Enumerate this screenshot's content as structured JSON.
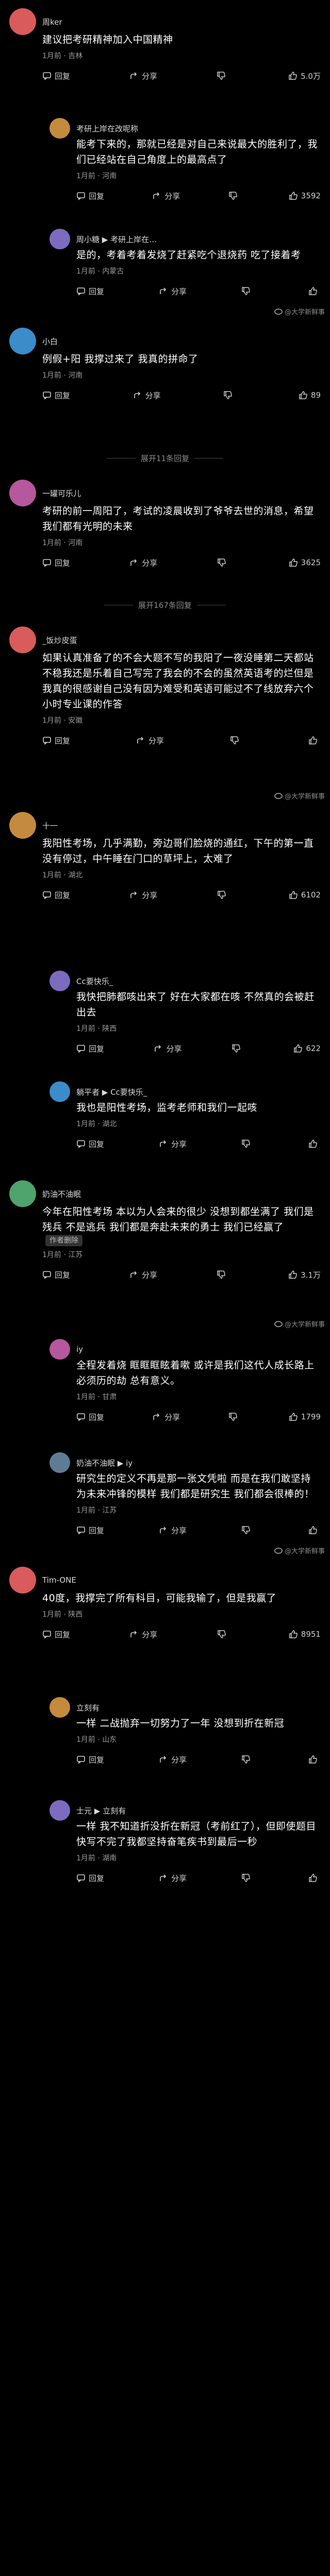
{
  "ui": {
    "watermark": "@大学新鲜事",
    "author_tag": "作者删除"
  },
  "posts": [
    {
      "id": "p1",
      "user": "周ker",
      "text": "建议把考研精神加入中国精神",
      "meta": "1月前 · 吉林",
      "reply_label": "回复",
      "share_label": "分享",
      "likes": "5.0万"
    },
    {
      "id": "r1",
      "reply": true,
      "user": "考研上岸在改呢称",
      "text": "能考下来的，那就已经是对自己来说最大的胜利了，我们已经站在自己角度上的最高点了",
      "meta": "1月前 · 河南",
      "reply_label": "回复",
      "share_label": "分享",
      "likes": "3592"
    },
    {
      "id": "r2",
      "reply": true,
      "user": "周小糖 ▶ 考研上岸在…",
      "text": "是的，考着考着发烧了赶紧吃个退烧药 吃了接着考",
      "meta": "1月前 · 内蒙古",
      "reply_label": "回复",
      "share_label": "分享",
      "likes": ""
    },
    {
      "id": "p2",
      "user": "小白",
      "text": "例假+阳 我撑过来了 我真的拼命了",
      "meta": "1月前 · 河南",
      "reply_label": "回复",
      "share_label": "分享",
      "likes": "89"
    },
    {
      "id": "more1",
      "more": true,
      "label": "展开11条回复"
    },
    {
      "id": "p3",
      "user": "一罐可乐儿",
      "text": "考研的前一周阳了，考试的凌晨收到了爷爷去世的消息，希望我们都有光明的未来",
      "meta": "1月前 · 河南",
      "reply_label": "回复",
      "share_label": "分享",
      "likes": "3625"
    },
    {
      "id": "more2",
      "more": true,
      "label": "展开167条回复"
    },
    {
      "id": "p4",
      "user": "_饭炒皮蛋",
      "text": "如果认真准备了的不会大题不写的我阳了一夜没睡第二天都站不稳我还是乐着自己写完了我会的不会的虽然英语考的烂但是我真的很感谢自己没有因为难受和英语可能过不了线放弃六个小时专业课的作答",
      "meta": "1月前 · 安徽",
      "reply_label": "回复",
      "share_label": "分享",
      "likes": ""
    },
    {
      "id": "p5",
      "user": "十一",
      "text": "我阳性考场，几乎满勤，旁边哥们脸烧的通红，下午的第一直没有停过，中午睡在门口的草坪上，太难了",
      "meta": "1月前 · 湖北",
      "reply_label": "回复",
      "share_label": "分享",
      "likes": "6102"
    },
    {
      "id": "r3",
      "reply": true,
      "user": "Cc要快乐_",
      "text": "我快把肺都咳出来了 好在大家都在咳 不然真的会被赶出去",
      "meta": "1月前 · 陕西",
      "reply_label": "回复",
      "share_label": "分享",
      "likes": "622"
    },
    {
      "id": "r4",
      "reply": true,
      "user": "躺平者 ▶ Cc要快乐_",
      "text": "我也是阳性考场，监考老师和我们一起咳",
      "meta": "1月前 · 湖北",
      "reply_label": "回复",
      "share_label": "分享",
      "likes": ""
    },
    {
      "id": "p6",
      "user": "奶油不油眠",
      "text": "今年在阳性考场 本以为人会来的很少 没想到都坐满了 我们是残兵 不是逃兵 我们都是奔赴未来的勇士 我们已经赢了",
      "meta": "1月前 · 江苏",
      "reply_label": "回复",
      "share_label": "分享",
      "likes": "3.1万",
      "author_deleted": true
    },
    {
      "id": "r5",
      "reply": true,
      "user": "iy",
      "text": "全程发着烧 眶眶眶眩着嗽 或许是我们这代人成长路上必须历的劫 总有意义。",
      "meta": "1月前 · 甘肃",
      "reply_label": "回复",
      "share_label": "分享",
      "likes": "1799"
    },
    {
      "id": "r6",
      "reply": true,
      "user": "奶油不油眠 ▶ iy",
      "text": "研究生的定义不再是那一张文凭啦 而是在我们敢坚持为未来冲锋的模样 我们都是研究生 我们都会很棒的！",
      "meta": "1月前 · 江苏",
      "reply_label": "回复",
      "share_label": "分享",
      "likes": ""
    },
    {
      "id": "p7",
      "user": "Tim-ONE",
      "text": "40度，我撑完了所有科目，可能我输了，但是我赢了",
      "meta": "1月前 · 陕西",
      "reply_label": "回复",
      "share_label": "分享",
      "likes": "8951"
    },
    {
      "id": "r7",
      "reply": true,
      "user": "立刻有",
      "text": "一样 二战抛弃一切努力了一年 没想到折在新冠",
      "meta": "1月前 · 山东",
      "reply_label": "回复",
      "share_label": "分享",
      "likes": ""
    },
    {
      "id": "r8",
      "reply": true,
      "user": "士元 ▶ 立刻有",
      "text": "一样 我不知道折没折在新冠（考前红了），但即使题目快写不完了我都坚持奋笔疾书到最后一秒",
      "meta": "1月前 · 湖南",
      "reply_label": "回复",
      "share_label": "分享",
      "likes": ""
    }
  ],
  "colors": {
    "bg": "#000000",
    "text": "#ffffff",
    "muted": "#9a9a9a"
  }
}
